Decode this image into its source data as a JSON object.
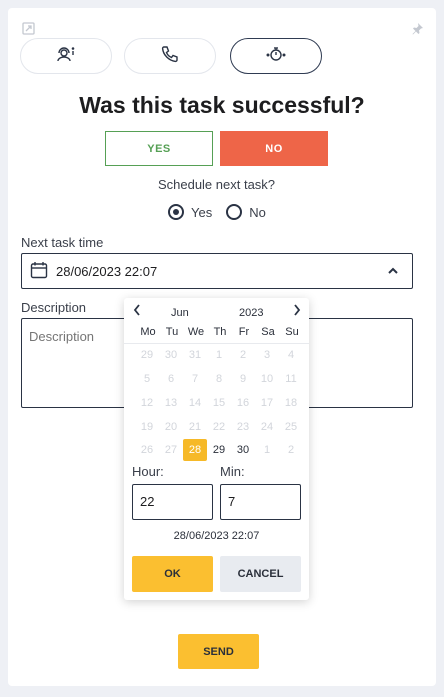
{
  "modes": [
    {
      "icon": "agent-headset-icon",
      "active": false
    },
    {
      "icon": "phone-icon",
      "active": false
    },
    {
      "icon": "timer-icon",
      "active": true
    }
  ],
  "title": "Was this task successful?",
  "success": {
    "yes_label": "YES",
    "no_label": "NO",
    "selected": "NO"
  },
  "schedule": {
    "label": "Schedule next task?",
    "options": [
      "Yes",
      "No"
    ],
    "selected": "Yes"
  },
  "next_task": {
    "label": "Next task time",
    "value": "28/06/2023 22:07"
  },
  "description": {
    "label": "Description",
    "placeholder": "Description"
  },
  "picker": {
    "month": "Jun",
    "year": "2023",
    "weekdays": [
      "Mo",
      "Tu",
      "We",
      "Th",
      "Fr",
      "Sa",
      "Su"
    ],
    "weeks": [
      [
        "29",
        "30",
        "31",
        "1",
        "2",
        "3",
        "4"
      ],
      [
        "5",
        "6",
        "7",
        "8",
        "9",
        "10",
        "11"
      ],
      [
        "12",
        "13",
        "14",
        "15",
        "16",
        "17",
        "18"
      ],
      [
        "19",
        "20",
        "21",
        "22",
        "23",
        "24",
        "25"
      ],
      [
        "26",
        "27",
        "28",
        "29",
        "30",
        "1",
        "2"
      ]
    ],
    "enabled_days": [
      "28",
      "29",
      "30"
    ],
    "selected_day": "28",
    "hour_label": "Hour:",
    "hour_value": "22",
    "min_label": "Min:",
    "min_value": "7",
    "summary": "28/06/2023 22:07",
    "ok_label": "OK",
    "cancel_label": "CANCEL"
  },
  "send_label": "SEND",
  "colors": {
    "yes_green": "#56a055",
    "no_orange": "#ee6548",
    "accent_yellow": "#fbbf30",
    "dark": "#2a3344"
  }
}
